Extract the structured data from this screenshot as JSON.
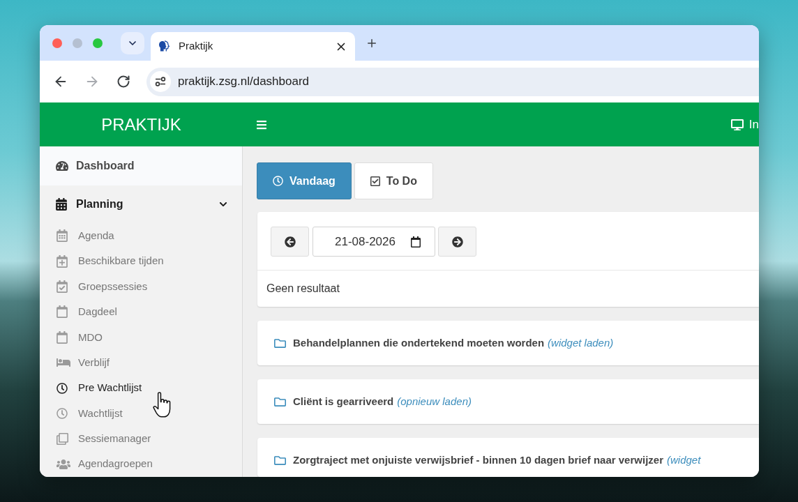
{
  "browser": {
    "tabs": [
      {
        "title": "Praktijk",
        "selected": true
      }
    ],
    "back": {
      "disabled": false
    },
    "forward": {
      "disabled": true
    },
    "url": "praktijk.zsg.nl/dashboard"
  },
  "header": {
    "logo": "PRAKTIJK",
    "right_label": "In"
  },
  "sidebar": {
    "items": [
      {
        "label": "Dashboard",
        "selected": true
      },
      {
        "label": "Planning",
        "selected": false,
        "expanded": true,
        "children": [
          {
            "label": "Agenda",
            "hovered": false
          },
          {
            "label": "Beschikbare tijden",
            "hovered": false
          },
          {
            "label": "Groepssessies",
            "hovered": false
          },
          {
            "label": "Dagdeel",
            "hovered": false
          },
          {
            "label": "MDO",
            "hovered": false
          },
          {
            "label": "Verblijf",
            "hovered": false
          },
          {
            "label": "Pre Wachtlijst",
            "hovered": true
          },
          {
            "label": "Wachtlijst",
            "hovered": false
          },
          {
            "label": "Sessiemanager",
            "hovered": false
          },
          {
            "label": "Agendagroepen",
            "hovered": false
          }
        ]
      }
    ]
  },
  "main": {
    "tabs": [
      {
        "label": "Vandaag",
        "selected": true
      },
      {
        "label": "To Do",
        "selected": false
      }
    ],
    "date_card": {
      "date": "21-08-2026",
      "message": "Geen resultaat"
    },
    "widgets": [
      {
        "title": "Behandelplannen die ondertekend moeten worden",
        "action": "(widget laden)"
      },
      {
        "title": "Cliënt is gearriveerd",
        "action": "(opnieuw laden)"
      },
      {
        "title": "Zorgtraject met onjuiste verwijsbrief - binnen 10 dagen brief naar verwijzer",
        "action": "(widget"
      }
    ]
  }
}
